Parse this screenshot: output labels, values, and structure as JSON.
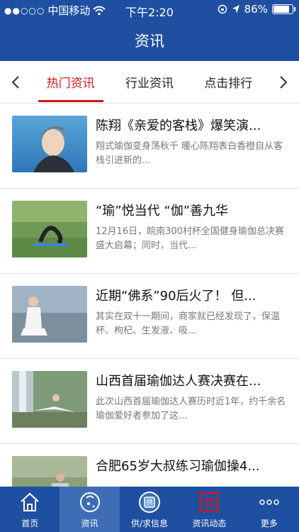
{
  "status": {
    "carrier": "中国移动",
    "time": "下午2:20",
    "battery": "86%",
    "battery_level": 0.86
  },
  "header": {
    "title": "资讯"
  },
  "tabs": {
    "prev": "‹",
    "next": "›",
    "items": [
      {
        "label": "热门资讯"
      },
      {
        "label": "行业资讯"
      },
      {
        "label": "点击排行"
      }
    ]
  },
  "articles": [
    {
      "title": "陈翔《亲爱的客栈》爆笑演...",
      "desc": "翔式瑜伽变身荡秋千 暖心陈翔表白香橙自从客栈引进新的..."
    },
    {
      "title": "“瑜”悦当代 “伽”善九华",
      "desc": "12月16日，皖南300村杯全国健身瑜伽总决赛盛大启幕；同时，当代..."
    },
    {
      "title": "近期“佛系”90后火了！ 但...",
      "desc": "其实在双十一期间，商家就已经发现了，保温杯、枸杞、生发液、吸..."
    },
    {
      "title": "山西首届瑜伽达人赛决赛在...",
      "desc": "此次山西首届瑜伽达人赛历时近1年，约千余名瑜伽爱好者参加了这..."
    },
    {
      "title": "合肥65岁大叔练习瑜伽操4...",
      "desc": ""
    }
  ],
  "tabbar": {
    "items": [
      {
        "label": "首页",
        "icon": "home-icon"
      },
      {
        "label": "资讯",
        "icon": "news-icon"
      },
      {
        "label": "供/求信息",
        "icon": "supply-icon"
      },
      {
        "label": "资讯动态",
        "icon": "list-icon"
      },
      {
        "label": "更多",
        "icon": "more-icon"
      }
    ]
  },
  "colors": {
    "brand": "#1f4fa0",
    "accent": "#d0191b"
  }
}
